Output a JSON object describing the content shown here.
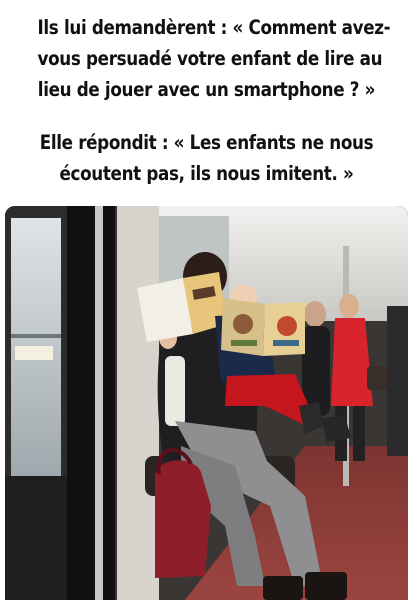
{
  "caption": {
    "line1": "Ils lui demandèrent : « Comment avez-",
    "line2": "vous persuadé votre enfant de lire au",
    "line3": "lieu de jouer avec un smartphone ? »",
    "line4": "Elle répondit : « Les enfants ne nous",
    "line5": "écoutent pas, ils nous imitent. »"
  },
  "colors": {
    "text": "#111111",
    "background": "#ffffff",
    "floor": "#8b3a36",
    "child_pants": "#c4161c",
    "bag": "#8e1e2a",
    "passenger_coat": "#d8242a"
  },
  "icons": [
    "book-icon",
    "child-book-icon"
  ]
}
